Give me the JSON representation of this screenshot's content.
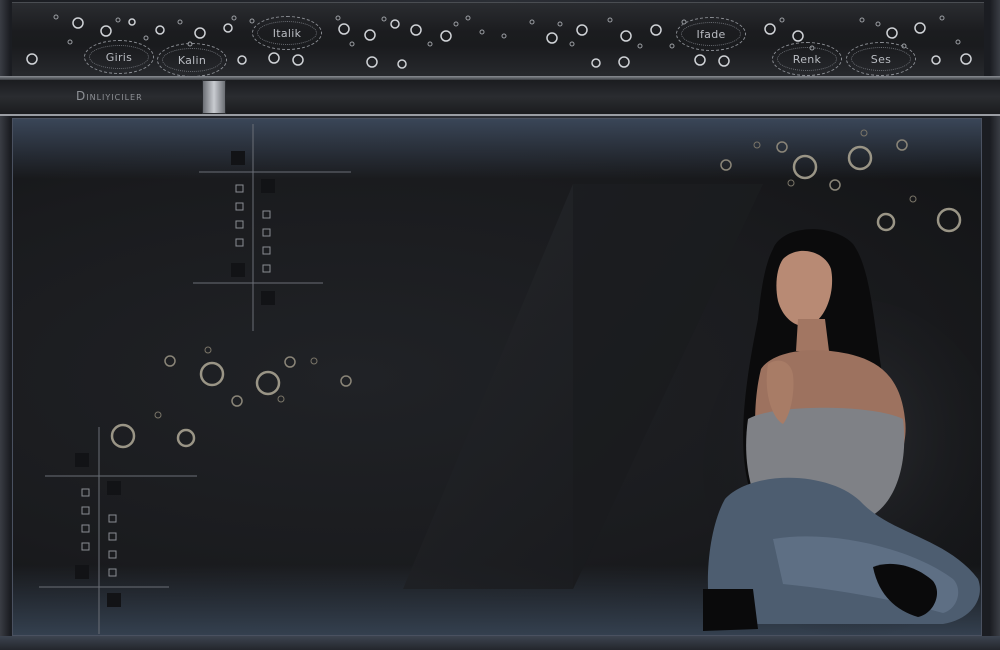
{
  "toolbar": {
    "buttons": [
      {
        "key": "giris",
        "label": "Giris"
      },
      {
        "key": "kalin",
        "label": "Kalin"
      },
      {
        "key": "italik",
        "label": "Italik"
      },
      {
        "key": "ifade",
        "label": "Ifade"
      },
      {
        "key": "renk",
        "label": "Renk"
      },
      {
        "key": "ses",
        "label": "Ses"
      }
    ]
  },
  "listeners": {
    "label": "Dinliyiciler"
  },
  "colors": {
    "accent_ring": "#9a9586",
    "grid_line": "#5a5f68",
    "stage_border": "#4a5160"
  },
  "main": {
    "background_image": "woman-sitting-portrait"
  }
}
